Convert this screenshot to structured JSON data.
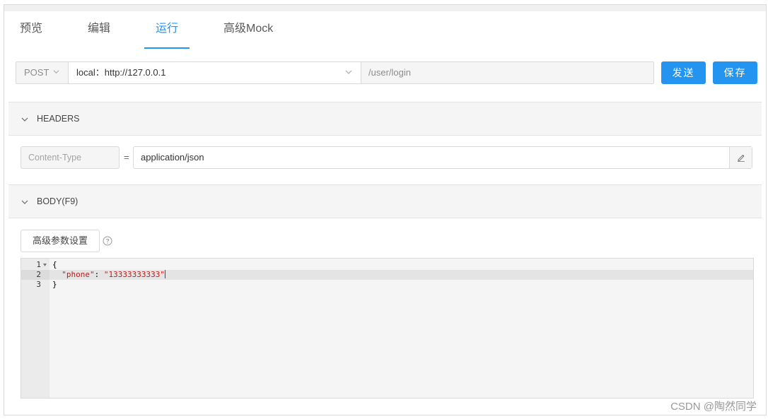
{
  "tabs": [
    "预览",
    "编辑",
    "运行",
    "高级Mock"
  ],
  "active_tab": "运行",
  "request": {
    "method": "POST",
    "environment": "local：http://127.0.0.1",
    "path": "/user/login",
    "send_label": "发送",
    "save_label": "保存"
  },
  "headers_panel": {
    "title": "HEADERS",
    "rows": [
      {
        "key_placeholder": "Content-Type",
        "value": "application/json"
      }
    ]
  },
  "body_panel": {
    "title": "BODY(F9)",
    "advanced_label": "高级参数设置",
    "lines": [
      {
        "num": "1",
        "brace": "{"
      },
      {
        "num": "2",
        "key": "\"phone\"",
        "sep": ": ",
        "value": "\"13333333333\""
      },
      {
        "num": "3",
        "brace": "}"
      }
    ]
  },
  "watermark": "CSDN @陶然同学",
  "colors": {
    "accent": "#2395f1",
    "json_string": "#c41a16"
  }
}
